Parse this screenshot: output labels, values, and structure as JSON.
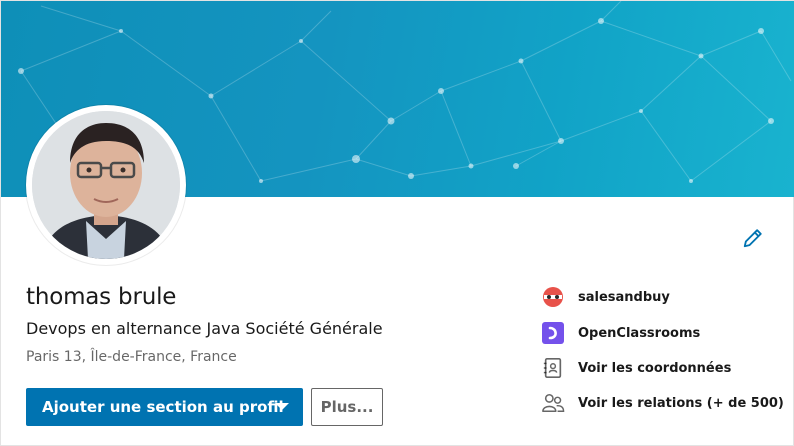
{
  "profile": {
    "name": "thomas brule",
    "headline": "Devops en alternance Java Société Générale",
    "location": "Paris 13, Île-de-France, France"
  },
  "actions": {
    "primary_label": "Ajouter une section au profil",
    "more_label": "Plus..."
  },
  "sidebar": {
    "items": [
      {
        "label": "salesandbuy",
        "icon": "salesandbuy-logo-icon"
      },
      {
        "label": "OpenClassrooms",
        "icon": "openclassrooms-logo-icon"
      },
      {
        "label": "Voir les coordonnées",
        "icon": "contact-card-icon"
      },
      {
        "label": "Voir les relations (+ de 500)",
        "icon": "people-icon"
      }
    ]
  },
  "colors": {
    "primary": "#0073b1",
    "banner": "#1494c0",
    "openclassrooms": "#7451eb",
    "salesandbuy": "#e8524a"
  }
}
